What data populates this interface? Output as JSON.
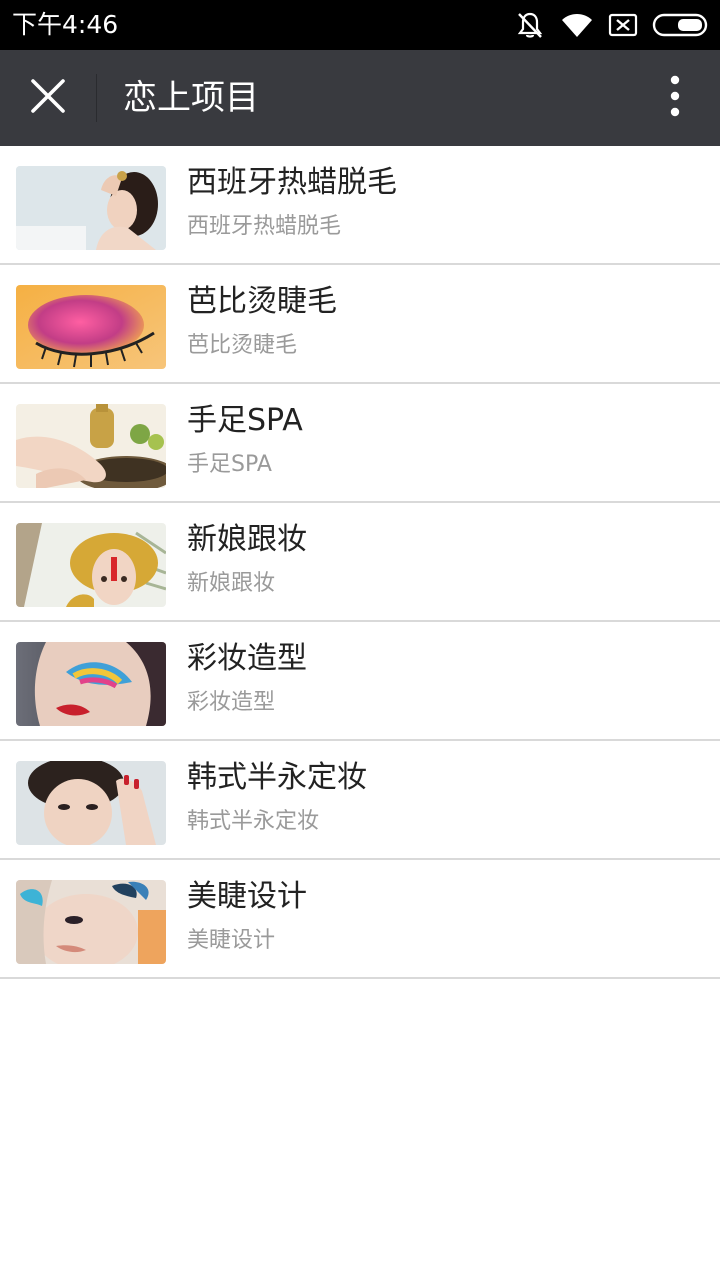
{
  "status_bar": {
    "time": "下午4:46",
    "icons": [
      "mute-vibrate-icon",
      "wifi-icon",
      "no-sim-icon",
      "battery-icon"
    ]
  },
  "app_bar": {
    "title": "恋上项目",
    "close_icon": "close-icon",
    "more_icon": "more-vertical-icon",
    "background": "#393a3f"
  },
  "items": [
    {
      "title": "西班牙热蜡脱毛",
      "subtitle": "西班牙热蜡脱毛",
      "thumb": "portrait-woman-hand-raised"
    },
    {
      "title": "芭比烫睫毛",
      "subtitle": "芭比烫睫毛",
      "thumb": "pink-eye-makeup"
    },
    {
      "title": "手足SPA",
      "subtitle": "手足SPA",
      "thumb": "hand-spa-oil"
    },
    {
      "title": "新娘跟妆",
      "subtitle": "新娘跟妆",
      "thumb": "bride-golden-headdress"
    },
    {
      "title": "彩妆造型",
      "subtitle": "彩妆造型",
      "thumb": "colorful-face-makeup"
    },
    {
      "title": "韩式半永定妆",
      "subtitle": "韩式半永定妆",
      "thumb": "woman-hand-face"
    },
    {
      "title": "美睫设计",
      "subtitle": "美睫设计",
      "thumb": "butterfly-eyelash-design"
    }
  ]
}
